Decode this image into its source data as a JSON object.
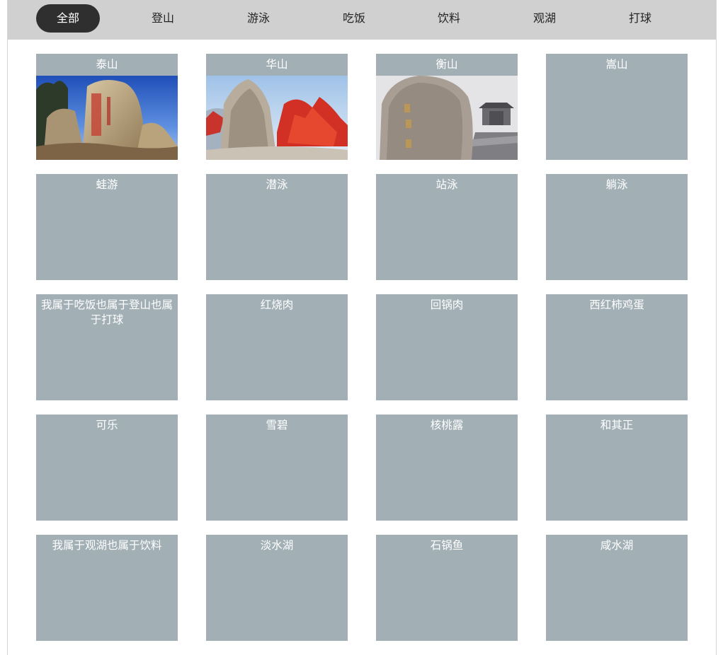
{
  "tabs": [
    {
      "label": "全部",
      "active": true
    },
    {
      "label": "登山",
      "active": false
    },
    {
      "label": "游泳",
      "active": false
    },
    {
      "label": "吃饭",
      "active": false
    },
    {
      "label": "饮料",
      "active": false
    },
    {
      "label": "观湖",
      "active": false
    },
    {
      "label": "打球",
      "active": false
    }
  ],
  "cards": [
    {
      "title": "泰山",
      "image": "taishan-rock-photo"
    },
    {
      "title": "华山",
      "image": "huashan-rock-photo"
    },
    {
      "title": "衡山",
      "image": "hengshan-rock-photo"
    },
    {
      "title": "嵩山"
    },
    {
      "title": "蛙游"
    },
    {
      "title": "潜泳"
    },
    {
      "title": "站泳"
    },
    {
      "title": "躺泳"
    },
    {
      "title": "我属于吃饭也属于登山也属于打球"
    },
    {
      "title": "红烧肉"
    },
    {
      "title": "回锅肉"
    },
    {
      "title": "西红柿鸡蛋"
    },
    {
      "title": "可乐"
    },
    {
      "title": "雪碧"
    },
    {
      "title": "核桃露"
    },
    {
      "title": "和其正"
    },
    {
      "title": "我属于观湖也属于饮料"
    },
    {
      "title": "淡水湖"
    },
    {
      "title": "石锅鱼"
    },
    {
      "title": "咸水湖"
    }
  ],
  "colors": {
    "tabbar_bg": "#d0d0d0",
    "active_tab_bg": "#2f2f2f",
    "card_bg": "#a2b0b6",
    "card_text": "#ffffff"
  }
}
